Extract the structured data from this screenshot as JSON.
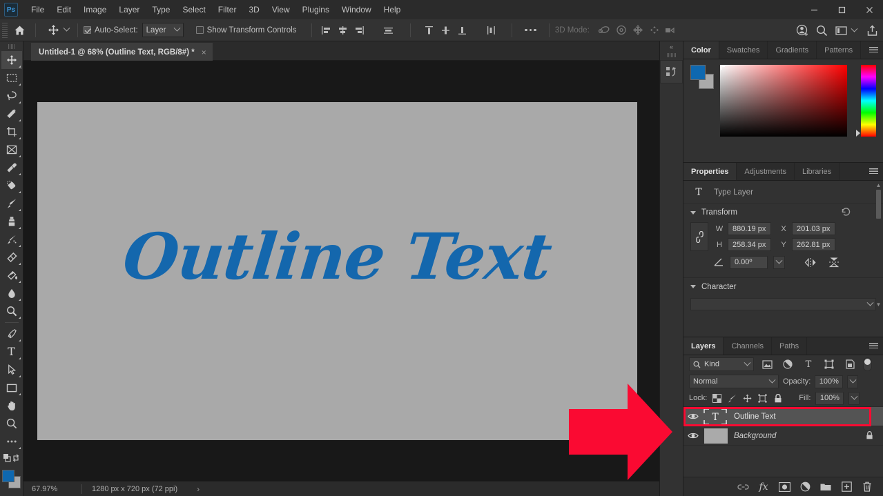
{
  "app": {
    "name": "Adobe Photoshop",
    "logo_text": "Ps",
    "accent_color": "#0e68b0",
    "annotation_color": "#fa0a32",
    "artwork_color": "#1467ad"
  },
  "menubar": {
    "items": [
      "File",
      "Edit",
      "Image",
      "Layer",
      "Type",
      "Select",
      "Filter",
      "3D",
      "View",
      "Plugins",
      "Window",
      "Help"
    ],
    "window_controls": [
      "minimize",
      "maximize",
      "close"
    ]
  },
  "options_bar": {
    "home_icon": "home-icon",
    "tool_icon": "move-tool-icon",
    "auto_select": {
      "label": "Auto-Select:",
      "checked": true
    },
    "auto_select_scope": "Layer",
    "show_transform_controls": {
      "label": "Show Transform Controls",
      "checked": false
    },
    "align_group_1": [
      "align-left-edges",
      "align-horizontal-centers",
      "align-right-edges",
      "distribute-horizontal"
    ],
    "align_group_2": [
      "align-top-edges",
      "align-vertical-centers",
      "align-bottom-edges",
      "distribute-vertical"
    ],
    "more_label": "...",
    "three_d_mode_label": "3D Mode:",
    "three_d_icons": [
      "orbit-3d-icon",
      "roll-3d-icon",
      "pan-3d-icon",
      "slide-3d-icon",
      "camera-3d-icon"
    ],
    "right_icons": [
      "share-user-icon",
      "search-icon",
      "workspace-icon",
      "export-icon"
    ]
  },
  "toolbar": {
    "tools": [
      "move-tool",
      "rectangular-marquee-tool",
      "lasso-tool",
      "magic-wand-tool",
      "crop-tool",
      "frame-tool",
      "eyedropper-tool",
      "spot-healing-brush-tool",
      "brush-tool",
      "clone-stamp-tool",
      "history-brush-tool",
      "eraser-tool",
      "gradient-tool",
      "blur-tool",
      "dodge-tool",
      "pen-tool",
      "horizontal-type-tool",
      "path-selection-tool",
      "rectangle-tool",
      "hand-tool",
      "zoom-tool",
      "edit-toolbar"
    ],
    "active_tool": "move-tool",
    "foreground_color": "#0e68b0",
    "background_color": "#aaaaaa"
  },
  "document": {
    "tab_title": "Untitled-1 @ 68% (Outline Text, RGB/8#) *",
    "close_label": "×",
    "artwork_text": "Outline Text"
  },
  "status_bar": {
    "zoom": "67.97%",
    "dimensions": "1280 px x 720 px (72 ppi)",
    "expand_arrow": "›"
  },
  "dock_strip": {
    "collapse_label": "«",
    "icon": "history-actions-icon"
  },
  "color_panel": {
    "tabs": [
      "Color",
      "Swatches",
      "Gradients",
      "Patterns"
    ],
    "active_tab": "Color",
    "foreground_color": "#0e68b0",
    "background_color": "#aaaaaa",
    "menu_icon": "panel-menu-icon"
  },
  "properties_panel": {
    "tabs": [
      "Properties",
      "Adjustments",
      "Libraries"
    ],
    "active_tab": "Properties",
    "layer_type_icon": "type-layer-icon",
    "layer_type_label": "Type Layer",
    "transform": {
      "section_title": "Transform",
      "reset_icon": "reset-icon",
      "link_icon": "link-icon",
      "w_label": "W",
      "w_value": "880.19 px",
      "h_label": "H",
      "h_value": "258.34 px",
      "x_label": "X",
      "x_value": "201.03 px",
      "y_label": "Y",
      "y_value": "262.81 px",
      "angle_icon": "angle-icon",
      "angle_value": "0.00º",
      "flip_horizontal_icon": "flip-horizontal-icon",
      "flip_vertical_icon": "flip-vertical-icon"
    },
    "character": {
      "section_title": "Character",
      "font_family_value": ""
    }
  },
  "layers_panel": {
    "tabs": [
      "Layers",
      "Channels",
      "Paths"
    ],
    "active_tab": "Layers",
    "menu_icon": "panel-menu-icon",
    "filter": {
      "search_icon": "search-icon",
      "kind_label": "Kind",
      "filter_icons": [
        "filter-pixel-icon",
        "filter-adjustment-icon",
        "filter-type-icon",
        "filter-shape-icon",
        "filter-smart-object-icon"
      ],
      "toggle_icon": "filter-toggle"
    },
    "blend_mode": "Normal",
    "opacity_label": "Opacity:",
    "opacity_value": "100%",
    "lock_label": "Lock:",
    "lock_icons": [
      "lock-transparent-pixels-icon",
      "lock-image-pixels-icon",
      "lock-position-icon",
      "lock-artboard-nesting-icon",
      "lock-all-icon"
    ],
    "fill_label": "Fill:",
    "fill_value": "100%",
    "layers": [
      {
        "name": "Outline Text",
        "type": "text",
        "visible": true,
        "selected": true,
        "locked": false,
        "highlighted": true
      },
      {
        "name": "Background",
        "type": "background",
        "visible": true,
        "selected": false,
        "locked": true,
        "highlighted": false
      }
    ],
    "footer_icons": [
      "link-layers-icon",
      "layer-style-fx-icon",
      "layer-mask-icon",
      "new-adjustment-layer-icon",
      "new-group-icon",
      "new-layer-icon",
      "delete-layer-icon"
    ]
  },
  "annotation": {
    "shape": "right-arrow",
    "color": "#fa0a32",
    "points_to": "Outline Text layer row"
  }
}
